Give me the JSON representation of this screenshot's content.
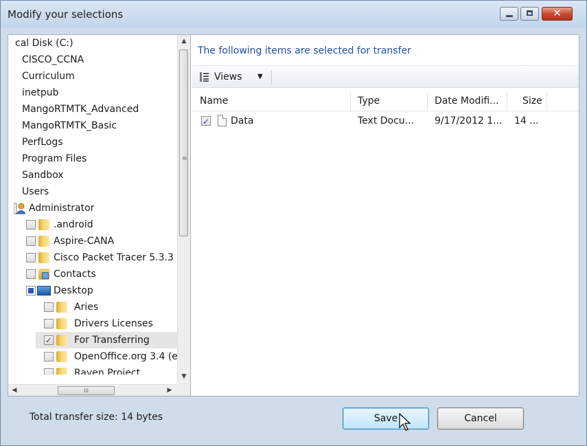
{
  "window": {
    "title": "Modify your selections",
    "close_glyph": "✕"
  },
  "tree": {
    "rows": [
      {
        "label": "cal Disk (C:)"
      },
      {
        "label": "CISCO_CCNA"
      },
      {
        "label": "Curriculum"
      },
      {
        "label": "inetpub"
      },
      {
        "label": "MangoRTMTK_Advanced"
      },
      {
        "label": "MangoRTMTK_Basic"
      },
      {
        "label": "PerfLogs"
      },
      {
        "label": "Program Files"
      },
      {
        "label": "Sandbox"
      },
      {
        "label": "Users"
      },
      {
        "label": "Administrator",
        "icon": "user-icon"
      },
      {
        "label": ".android",
        "checked": false,
        "icon": "folder-icon"
      },
      {
        "label": "Aspire-CANA",
        "checked": false,
        "icon": "folder-icon"
      },
      {
        "label": "Cisco Packet Tracer 5.3.3",
        "checked": false,
        "icon": "folder-icon"
      },
      {
        "label": "Contacts",
        "checked": false,
        "icon": "contacts-icon"
      },
      {
        "label": "Desktop",
        "checked": "partial",
        "icon": "desktop-icon"
      },
      {
        "label": "Aries",
        "checked": false,
        "icon": "folder-icon"
      },
      {
        "label": "Drivers Licenses",
        "checked": false,
        "icon": "folder-icon"
      },
      {
        "label": "For Transferring",
        "checked": true,
        "icon": "folder-icon",
        "highlighted": true
      },
      {
        "label": "OpenOffice.org 3.4 (e",
        "checked": false,
        "icon": "folder-icon"
      },
      {
        "label": "Raven Project",
        "checked": false,
        "icon": "folder-icon"
      }
    ],
    "scroll_grip": "≡",
    "hscroll_grip": "III"
  },
  "right": {
    "heading": "The following items are selected for transfer",
    "views_label": "Views",
    "views_arrow": "▼",
    "columns": {
      "name": "Name",
      "type": "Type",
      "date": "Date Modifi...",
      "size": "Size"
    },
    "files": [
      {
        "checked": true,
        "name": "Data",
        "type": "Text Docu...",
        "date": "9/17/2012 1...",
        "size": "14 ..."
      }
    ]
  },
  "footer": {
    "total_label": "Total transfer size: 14 bytes",
    "save_label": "Save",
    "cancel_label": "Cancel"
  },
  "colors": {
    "accent_heading": "#1f4fa6",
    "window_frame": "#cfdcea",
    "close_button": "#c6452c"
  }
}
